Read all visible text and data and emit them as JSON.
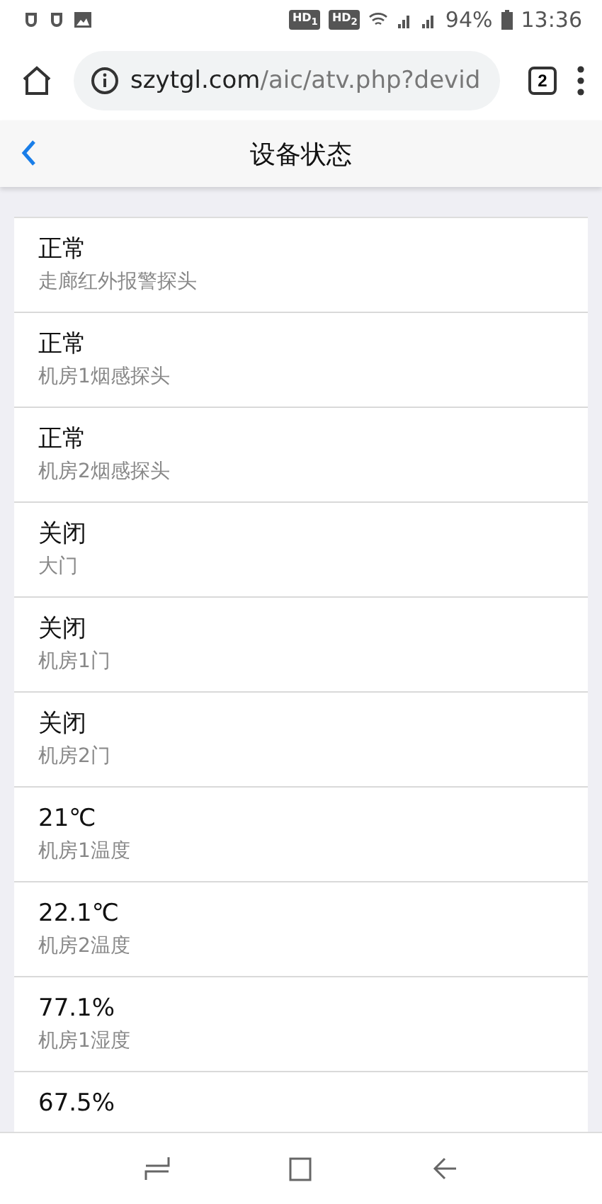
{
  "status_bar": {
    "badges": [
      "HD$_{1}$",
      "HD$_{2}$"
    ],
    "battery": "94%",
    "time": "13:36"
  },
  "browser": {
    "url_host": "szytgl.com",
    "url_path": "/aic/atv.php?devid",
    "tab_count": "2"
  },
  "header": {
    "title": "设备状态"
  },
  "devices": [
    {
      "value": "正常",
      "name": "走廊红外报警探头"
    },
    {
      "value": "正常",
      "name": "机房1烟感探头"
    },
    {
      "value": "正常",
      "name": "机房2烟感探头"
    },
    {
      "value": "关闭",
      "name": "大门"
    },
    {
      "value": "关闭",
      "name": "机房1门"
    },
    {
      "value": "关闭",
      "name": "机房2门"
    },
    {
      "value": "21℃",
      "name": "机房1温度"
    },
    {
      "value": "22.1℃",
      "name": "机房2温度"
    },
    {
      "value": "77.1%",
      "name": "机房1湿度"
    },
    {
      "value": "67.5%"
    }
  ]
}
